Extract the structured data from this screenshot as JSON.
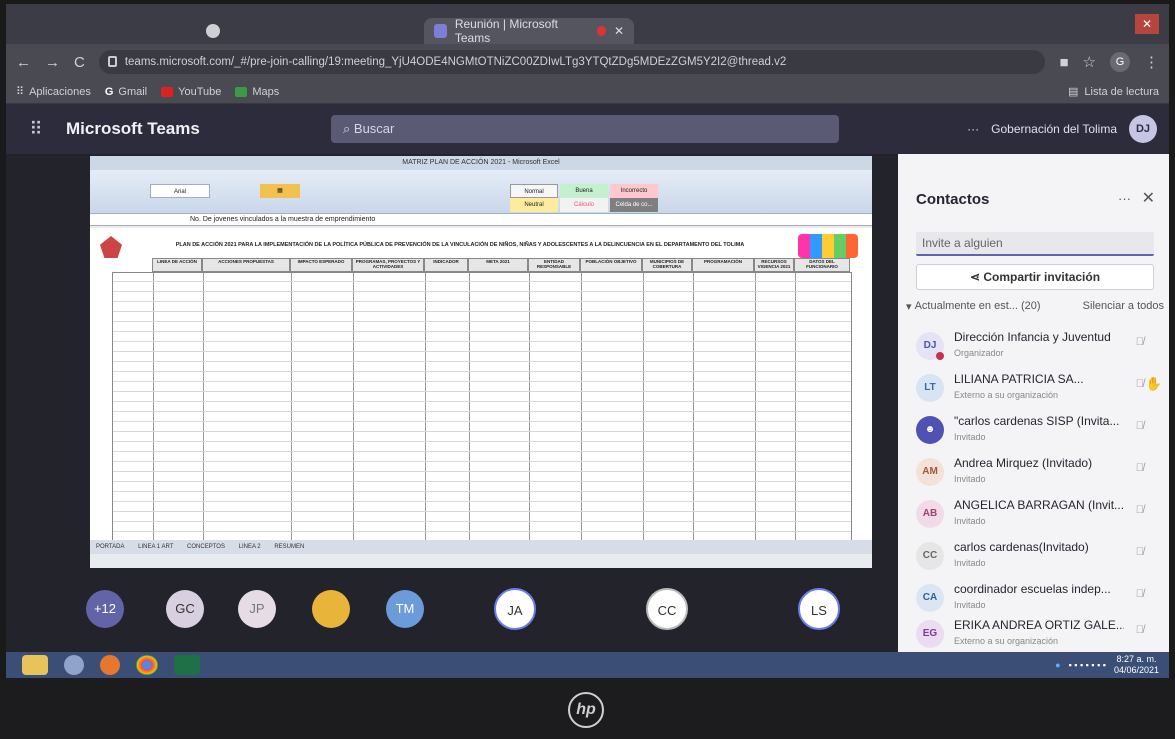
{
  "browser": {
    "tabs": [
      {
        "label": "",
        "icon": "whatsapp-icon"
      },
      {
        "label": "Reunión | Microsoft Teams",
        "icon": "teams-icon"
      }
    ],
    "url": "teams.microsoft.com/_#/pre-join-calling/19:meeting_YjU4ODE4NGMtOTNiZC00ZDIwLTg3YTQtZDg5MDEzZGM5Y2I2@thread.v2",
    "bookmarks": [
      "Aplicaciones",
      "Gmail",
      "YouTube",
      "Maps"
    ],
    "reading_list": "Lista de lectura"
  },
  "teams": {
    "title": "Microsoft Teams",
    "search_placeholder": "Buscar",
    "org": "Gobernación del Tolima",
    "user_initials": "DJ"
  },
  "excel": {
    "window_title": "MATRIZ PLAN DE ACCIÓN 2021 - Microsoft Excel",
    "formula": "No. De jovenes vinculados a la muestra de emprendimiento",
    "sheet_heading": "PLAN DE ACCIÓN 2021 PARA LA IMPLEMENTACIÓN DE LA POLÍTICA PÚBLICA DE PREVENCIÓN DE LA VINCULACIÓN DE NIÑOS, NIÑAS Y ADOLESCENTES A LA DELINCUENCIA EN EL DEPARTAMENTO DEL TOLIMA",
    "columns": [
      "LINEA DE ACCIÓN",
      "ACCIONES PROPUESTAS",
      "IMPACTO ESPERADO",
      "PROGRAMAS, PROYECTOS Y ACTIVIDADES",
      "INDICADOR",
      "META 2021",
      "ENTIDAD RESPONSABLE",
      "POBLACIÓN OBJETIVO",
      "MUNICIPIOS DE COBERTURA",
      "PROGRAMACIÓN",
      "RECURSOS VIGENCIA 2021",
      "DATOS DEL FUNCIONARIO"
    ],
    "sheet_tabs": [
      "PORTADA",
      "LINEA 1 ART",
      "CONCEPTOS",
      "LINEA 2",
      "RESUMEN"
    ]
  },
  "participants": {
    "overflow": "+12",
    "avatars": [
      "GC",
      "JP",
      "",
      "TM",
      "JA",
      "CC",
      "LS"
    ]
  },
  "contacts": {
    "title": "Contactos",
    "invite_placeholder": "Invite a alguien",
    "share_label": "Compartir invitación",
    "present_label": "Actualmente en est... (20)",
    "mute_all": "Silenciar a todos",
    "people": [
      {
        "initials": "DJ",
        "name": "Dirección Infancia y Juventud",
        "role": "Organizador",
        "color": "#e4e4f6"
      },
      {
        "initials": "LT",
        "name": "LILIANA PATRICIA SA...",
        "role": "Externo a su organización",
        "color": "#d6e4f4"
      },
      {
        "initials": "",
        "name": "\"carlos cardenas SISP (Invita...",
        "role": "Invitado",
        "color": "#4f52b2"
      },
      {
        "initials": "AM",
        "name": "Andrea Mirquez (Invitado)",
        "role": "Invitado",
        "color": "#f4e2d9"
      },
      {
        "initials": "AB",
        "name": "ANGELICA BARRAGAN (Invit...",
        "role": "Invitado",
        "color": "#f1dbe8"
      },
      {
        "initials": "CC",
        "name": "carlos cardenas(Invitado)",
        "role": "Invitado",
        "color": "#e6e6e6"
      },
      {
        "initials": "CA",
        "name": "coordinador escuelas indep...",
        "role": "Invitado",
        "color": "#dae6f3"
      },
      {
        "initials": "EG",
        "name": "ERIKA ANDREA ORTIZ GALE...",
        "role": "Externo a su organización",
        "color": "#eadcf1"
      }
    ]
  },
  "taskbar": {
    "time": "8:27 a. m.",
    "date": "04/06/2021"
  }
}
